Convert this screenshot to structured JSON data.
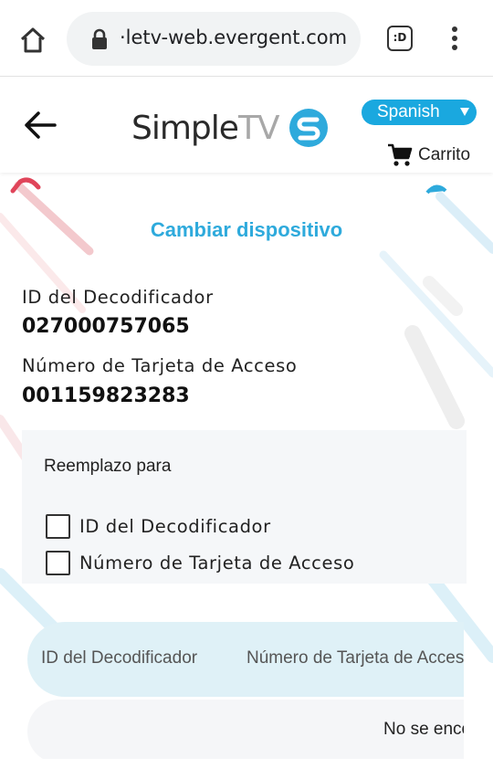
{
  "browser": {
    "url": "·letv-web.evergent.com",
    "tab_switcher_label": ":D"
  },
  "header": {
    "logo_simple": "Simple",
    "logo_tv": "TV",
    "language": "Spanish",
    "cart_label": "Carrito"
  },
  "page": {
    "title": "Cambiar dispositivo",
    "decoder_id_label": "ID del Decodificador",
    "decoder_id_value": "027000757065",
    "access_card_label": "Número de Tarjeta de Acceso",
    "access_card_value": "001159823283"
  },
  "replace": {
    "title": "Reemplazo para",
    "options": [
      {
        "label": "ID del Decodificador",
        "checked": false
      },
      {
        "label": "Número de Tarjeta de Acceso",
        "checked": false
      }
    ]
  },
  "table": {
    "columns": [
      "ID del Decodificador",
      "Número de Tarjeta de Acceso"
    ],
    "empty_message": "No se encontraron registros"
  },
  "colors": {
    "accent": "#2eaadc",
    "language_pill": "#1aa8df",
    "table_header": "#dff1f7"
  }
}
